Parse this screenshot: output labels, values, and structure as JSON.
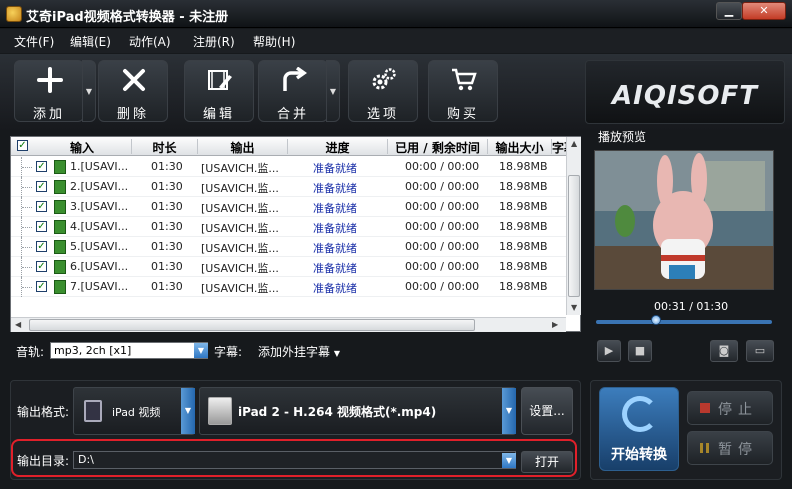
{
  "window": {
    "title": "艾奇iPad视频格式转换器 - 未注册"
  },
  "menu": [
    "文件(F)",
    "编辑(E)",
    "动作(A)",
    "注册(R)",
    "帮助(H)"
  ],
  "toolbar": {
    "add": "添加",
    "delete": "删除",
    "edit": "编辑",
    "merge": "合并",
    "options": "选项",
    "buy": "购买"
  },
  "logo": "AIQISOFT",
  "table": {
    "columns": [
      "输入",
      "时长",
      "输出",
      "进度",
      "已用 / 剩余时间",
      "输出大小",
      "字幕"
    ],
    "rows": [
      {
        "input": "1.[USAVI...",
        "duration": "01:30",
        "output": "[USAVICH.监...",
        "progress": "准备就绪",
        "time": "00:00 / 00:00",
        "size": "18.98MB"
      },
      {
        "input": "2.[USAVI...",
        "duration": "01:30",
        "output": "[USAVICH.监...",
        "progress": "准备就绪",
        "time": "00:00 / 00:00",
        "size": "18.98MB"
      },
      {
        "input": "3.[USAVI...",
        "duration": "01:30",
        "output": "[USAVICH.监...",
        "progress": "准备就绪",
        "time": "00:00 / 00:00",
        "size": "18.98MB"
      },
      {
        "input": "4.[USAVI...",
        "duration": "01:30",
        "output": "[USAVICH.监...",
        "progress": "准备就绪",
        "time": "00:00 / 00:00",
        "size": "18.98MB"
      },
      {
        "input": "5.[USAVI...",
        "duration": "01:30",
        "output": "[USAVICH.监...",
        "progress": "准备就绪",
        "time": "00:00 / 00:00",
        "size": "18.98MB"
      },
      {
        "input": "6.[USAVI...",
        "duration": "01:30",
        "output": "[USAVICH.监...",
        "progress": "准备就绪",
        "time": "00:00 / 00:00",
        "size": "18.98MB"
      },
      {
        "input": "7.[USAVI...",
        "duration": "01:30",
        "output": "[USAVICH.监...",
        "progress": "准备就绪",
        "time": "00:00 / 00:00",
        "size": "18.98MB"
      }
    ]
  },
  "audio": {
    "label": "音轨:",
    "value": "mp3, 2ch [x1]"
  },
  "subtitle": {
    "label": "字幕:",
    "value": "添加外挂字幕"
  },
  "preview": {
    "title": "播放预览",
    "time": "00:31 / 01:30",
    "position": 0.34
  },
  "output": {
    "format_label": "输出格式:",
    "device": "iPad 视频",
    "format": "iPad 2 - H.264 视频格式(*.mp4)",
    "settings": "设置...",
    "dir_label": "输出目录:",
    "dir_value": "D:\\",
    "open": "打开"
  },
  "controls": {
    "start": "开始转换",
    "stop": "停止",
    "pause": "暂停"
  }
}
